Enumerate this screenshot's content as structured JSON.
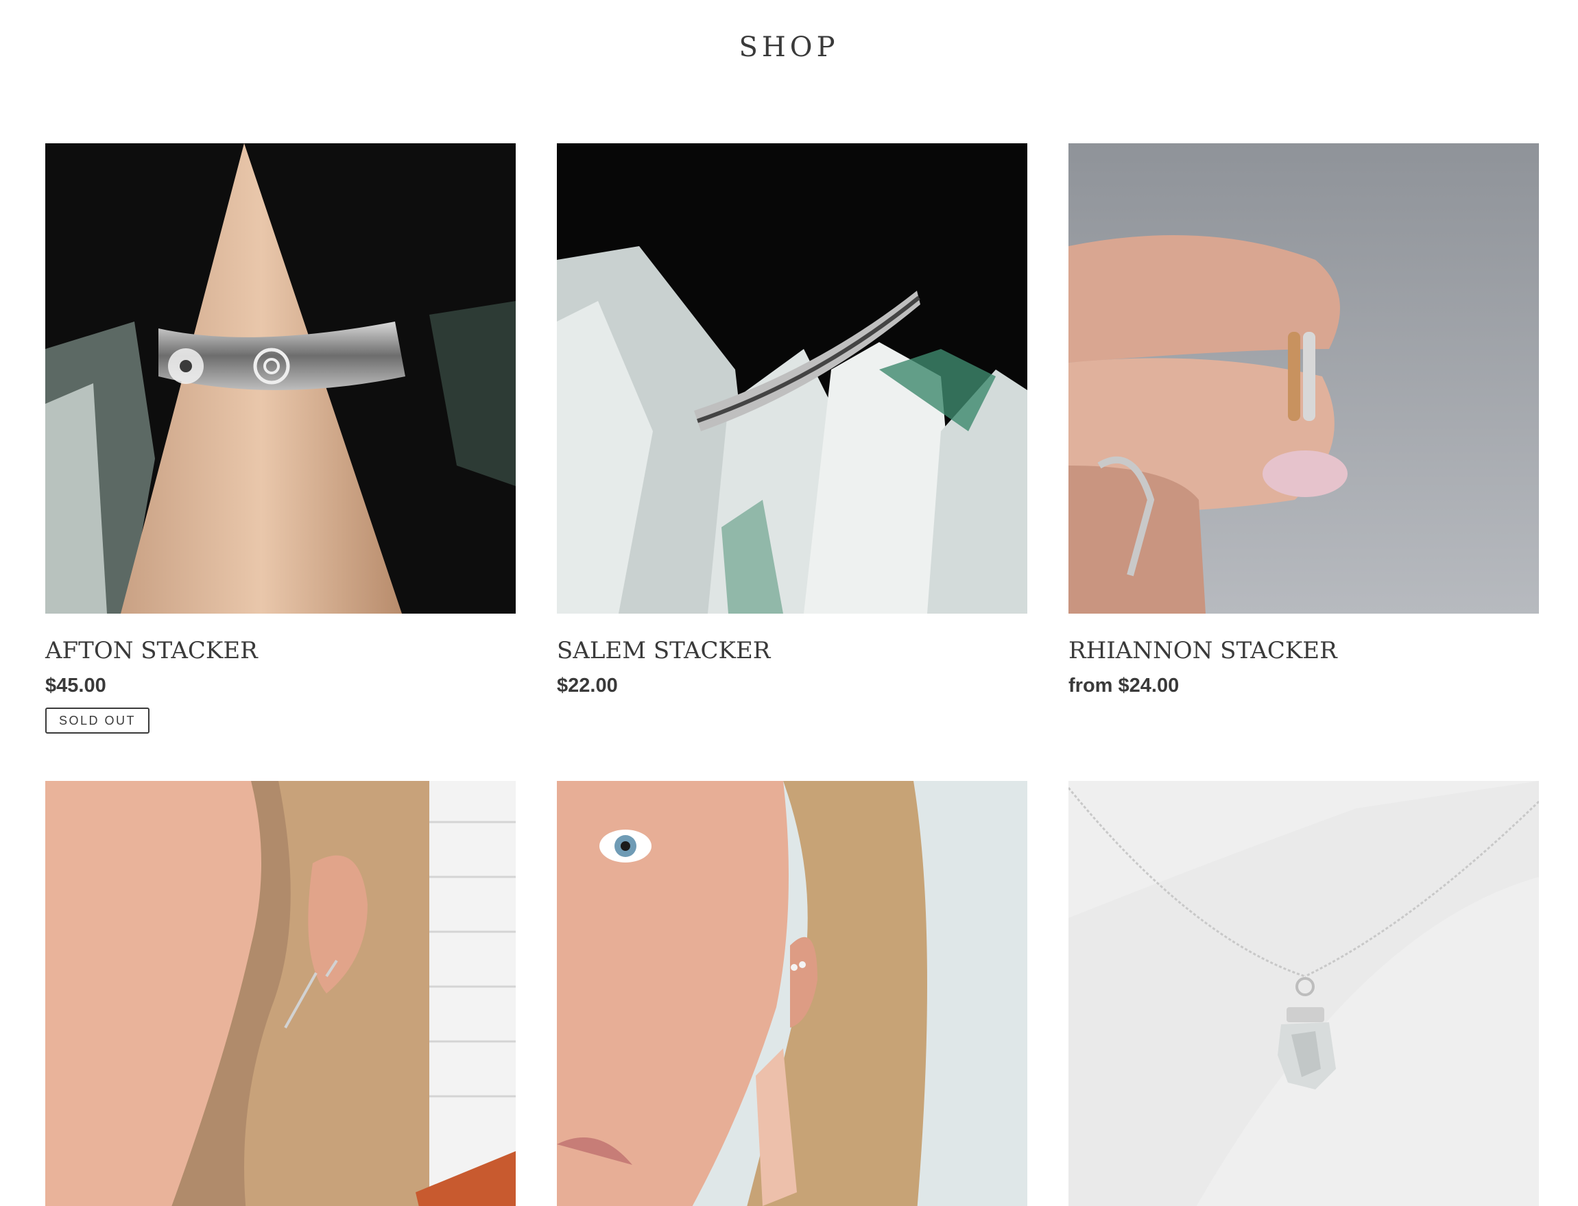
{
  "page": {
    "title": "SHOP"
  },
  "products": [
    {
      "title": "AFTON STACKER",
      "price": "$45.00",
      "badge": "SOLD OUT",
      "image": "ring-on-wooden-cone-photo"
    },
    {
      "title": "SALEM STACKER",
      "price": "$22.00",
      "image": "ring-on-quartz-crystal-photo"
    },
    {
      "title": "RHIANNON STACKER",
      "price": "from $24.00",
      "image": "rings-held-between-fingers-photo"
    },
    {
      "image": "bar-earrings-on-ear-photo"
    },
    {
      "image": "stud-earrings-on-ear-photo"
    },
    {
      "image": "crystal-pendant-necklace-photo"
    }
  ]
}
